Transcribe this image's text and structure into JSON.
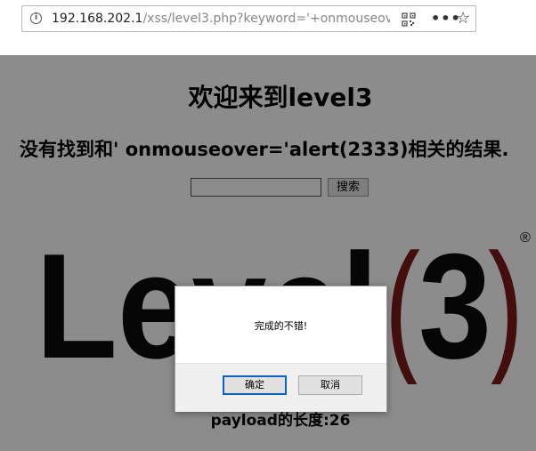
{
  "browser": {
    "url_host": "192.168.202.1",
    "url_path": "/xss/level3.php?keyword='+onmouseove",
    "more_label": "•••",
    "star_glyph": "☆"
  },
  "page": {
    "title": "欢迎来到level3",
    "result_text": "没有找到和' onmouseover='alert(2333)相关的结果.",
    "search": {
      "value": "",
      "button_label": "搜索"
    },
    "logo": {
      "word": "Level",
      "number": "3",
      "registered": "®"
    },
    "payload_text": "payload的长度:26"
  },
  "dialog": {
    "message": "完成的不错!",
    "ok_label": "确定",
    "cancel_label": "取消"
  },
  "colors": {
    "logo_dark": "#0c0c0c",
    "logo_red": "#7a1a14",
    "overlay": "#7a7a7a",
    "ok_focus": "#0a64c8"
  }
}
